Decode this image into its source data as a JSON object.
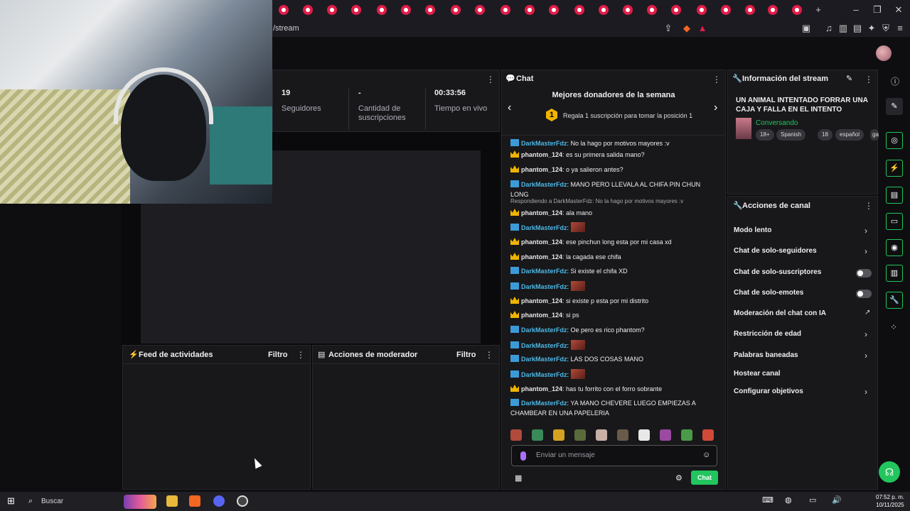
{
  "browser": {
    "url": "/stream",
    "new_tab": "+"
  },
  "stats": [
    {
      "value": "19",
      "label": "Seguidores"
    },
    {
      "value": "-",
      "label": "Cantidad de suscripciones"
    },
    {
      "value": "00:33:56",
      "label": "Tiempo en vivo"
    }
  ],
  "feed": {
    "title": "Feed de actividades",
    "filter": "Filtro"
  },
  "mod": {
    "title": "Acciones de moderador",
    "filter": "Filtro"
  },
  "chat": {
    "title": "Chat",
    "donors_title": "Mejores donadores de la semana",
    "donors_rank": "1",
    "donors_text": "Regala 1 suscripción para tomar la posición 1",
    "messages": [
      {
        "user": "DarkMasterFdz",
        "text": ": No la hago por motivos mayores :v"
      },
      {
        "user": "phantom_124",
        "text": ": es su primera salida mano?"
      },
      {
        "user": "phantom_124",
        "text": ": o ya salieron antes?"
      },
      {
        "user": "DarkMasterFdz",
        "text": ": MANO PERO LLEVALA AL CHIFA PIN CHUN LONG"
      },
      {
        "reply": "Respondiendo a DarkMasterFdz: No la hago por motivos mayores :v"
      },
      {
        "user": "phantom_124",
        "text": ": ala mano"
      },
      {
        "user": "DarkMasterFdz",
        "text": ":"
      },
      {
        "user": "phantom_124",
        "text": ": ese pinchun long esta por mi casa xd"
      },
      {
        "user": "phantom_124",
        "text": ": la cagada ese chifa"
      },
      {
        "user": "DarkMasterFdz",
        "text": ": Si existe el chifa XD"
      },
      {
        "user": "DarkMasterFdz",
        "text": ":"
      },
      {
        "user": "phantom_124",
        "text": ": si existe p esta por mi distrito"
      },
      {
        "user": "phantom_124",
        "text": ": si ps"
      },
      {
        "user": "DarkMasterFdz",
        "text": ": Oe pero es rico phantom?"
      },
      {
        "user": "DarkMasterFdz",
        "text": ":"
      },
      {
        "user": "DarkMasterFdz",
        "text": ": LAS DOS COSAS MANO"
      },
      {
        "user": "DarkMasterFdz",
        "text": ":"
      },
      {
        "user": "phantom_124",
        "text": ": has tu forrito con el forro sobrante"
      },
      {
        "user": "DarkMasterFdz",
        "text": ": YA MANO CHEVERE LUEGO EMPIEZAS A CHAMBEAR EN UNA PAPELERIA"
      }
    ],
    "input_placeholder": "Enviar un mensaje",
    "send_label": "Chat"
  },
  "info": {
    "title": "Información del stream",
    "stream_title": "UN ANIMAL INTENTADO FORRAR UNA CAJA Y FALLA EN EL INTENTO",
    "category": "Conversando",
    "tags": [
      "18+",
      "Spanish",
      "18",
      "español",
      "ga"
    ]
  },
  "acciones": {
    "title": "Acciones de canal",
    "items": [
      {
        "label": "Modo lento",
        "kind": "chevron"
      },
      {
        "label": "Chat de solo-seguidores",
        "kind": "chevron"
      },
      {
        "label": "Chat de solo-suscriptores",
        "kind": "toggle"
      },
      {
        "label": "Chat de solo-emotes",
        "kind": "toggle"
      },
      {
        "label": "Moderación del chat con IA",
        "kind": "external"
      },
      {
        "label": "Restricción de edad",
        "kind": "chevron"
      },
      {
        "label": "Palabras baneadas",
        "kind": "chevron"
      },
      {
        "label": "Hostear canal",
        "kind": "none"
      },
      {
        "label": "Configurar objetivos",
        "kind": "chevron"
      }
    ]
  },
  "taskbar": {
    "search": "Buscar",
    "time": "07:52 p. m.",
    "date": "10/11/2025"
  },
  "colors": {
    "accent": "#22c55e",
    "donor_gold": "#f0b400",
    "user_blue": "#4cb8e6"
  }
}
